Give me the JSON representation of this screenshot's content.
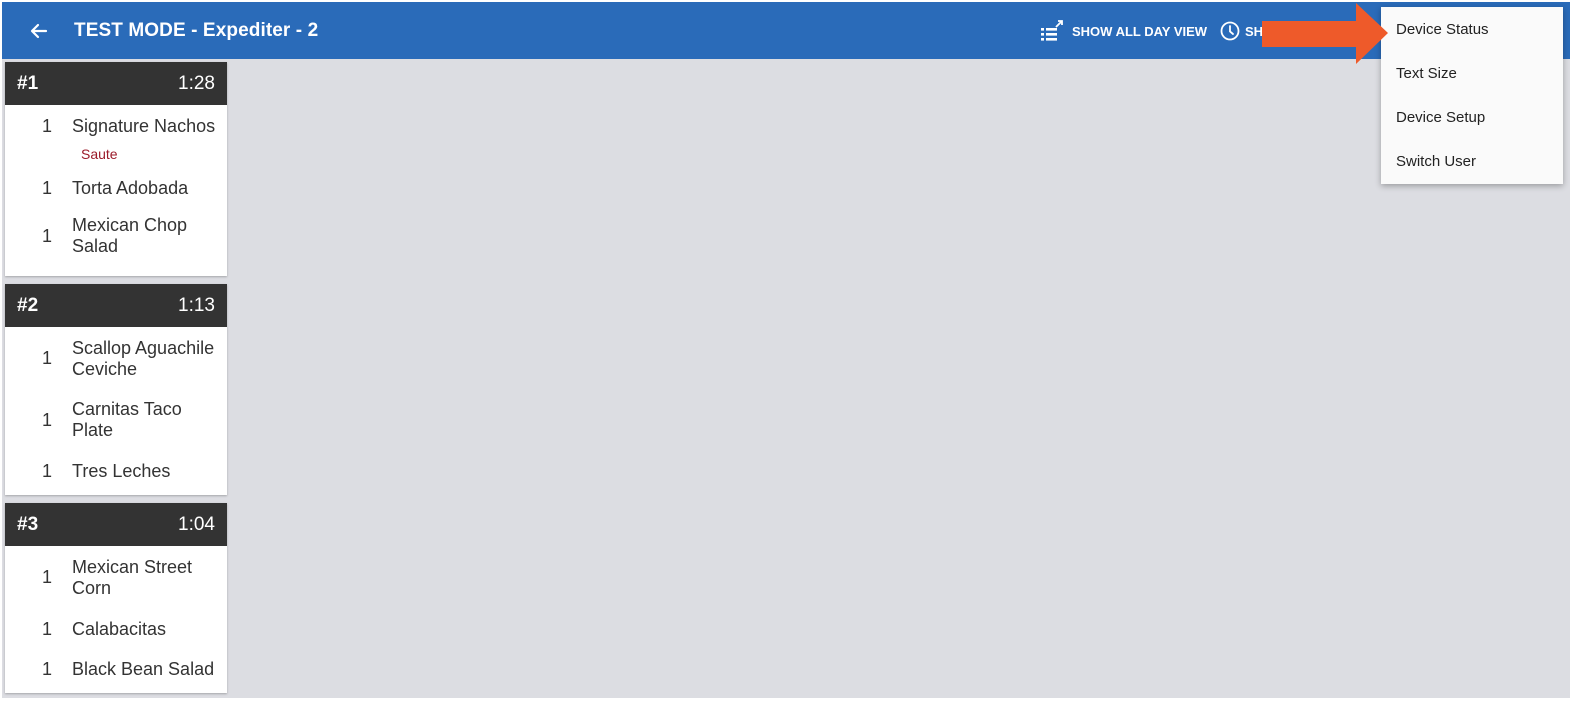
{
  "appbar": {
    "title": "TEST MODE - Expediter - 2",
    "show_all_day_label": "SHOW ALL DAY VIEW",
    "second_action_label": "SH"
  },
  "tickets": [
    {
      "number": "#1",
      "time": "1:28",
      "items": [
        {
          "qty": "1",
          "name": "Signature Nachos",
          "modifier": "Saute"
        },
        {
          "qty": "1",
          "name": "Torta Adobada"
        },
        {
          "qty": "1",
          "name": "Mexican Chop Salad"
        }
      ]
    },
    {
      "number": "#2",
      "time": "1:13",
      "items": [
        {
          "qty": "1",
          "name": "Scallop Aguachile Ceviche"
        },
        {
          "qty": "1",
          "name": "Carnitas Taco Plate"
        },
        {
          "qty": "1",
          "name": "Tres Leches"
        }
      ]
    },
    {
      "number": "#3",
      "time": "1:04",
      "items": [
        {
          "qty": "1",
          "name": "Mexican Street Corn"
        },
        {
          "qty": "1",
          "name": "Calabacitas"
        },
        {
          "qty": "1",
          "name": "Black Bean Salad"
        }
      ]
    }
  ],
  "menu": {
    "items": [
      "Device Status",
      "Text Size",
      "Device Setup",
      "Switch User"
    ]
  },
  "colors": {
    "appbar": "#2a6bb9",
    "ticket_header": "#333333",
    "modifier": "#9b1b2a",
    "arrow": "#ee5a2a",
    "background": "#dcdde2"
  }
}
